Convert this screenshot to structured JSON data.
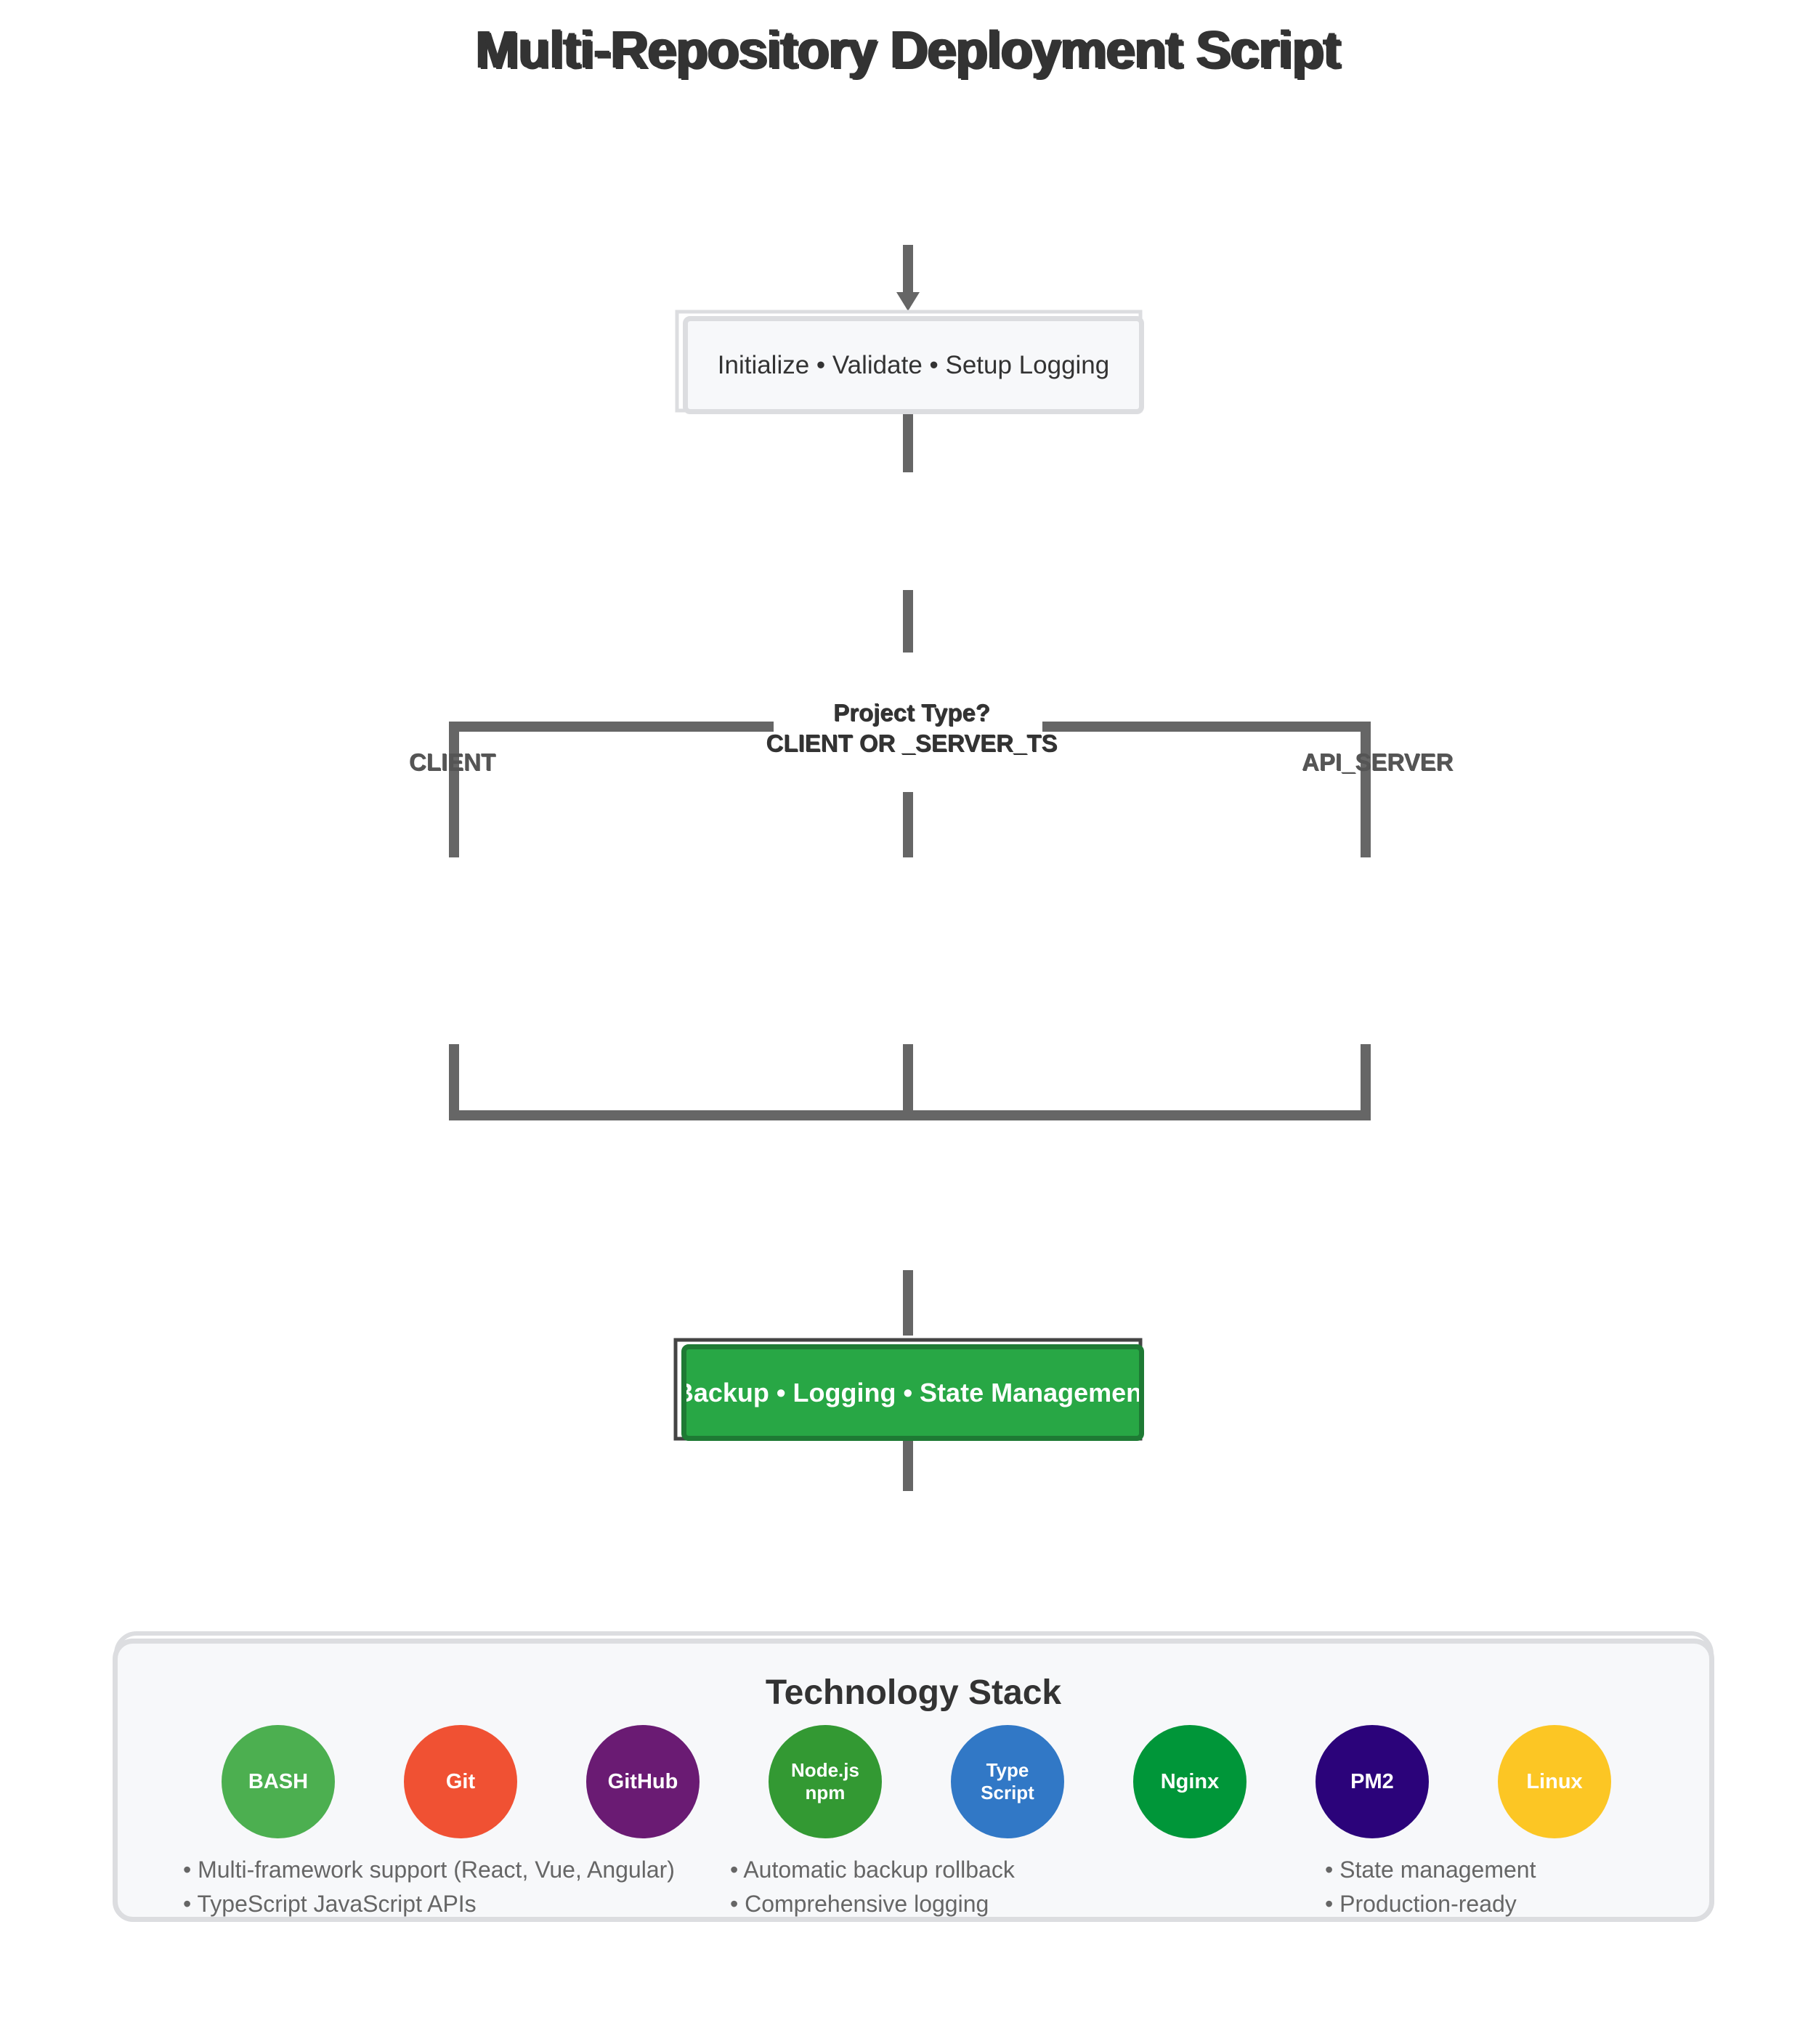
{
  "title": "Multi-Repository Deployment Script",
  "init_step": {
    "label": "Initialize • Validate • Setup Logging"
  },
  "decision": {
    "line1": "Project Type?",
    "line2": "CLIENT OR _SERVER_TS"
  },
  "branches": {
    "left": "CLIENT",
    "right": "API_SERVER"
  },
  "result_step": {
    "label": "Backup • Logging • State Management",
    "bg": "#28a745"
  },
  "tech_stack": {
    "title": "Technology Stack",
    "items": [
      {
        "label": "BASH",
        "color": "#4caf50"
      },
      {
        "label": "Git",
        "color": "#f05133"
      },
      {
        "label": "GitHub",
        "color": "#6a1b73"
      },
      {
        "label": "Node.js\nnpm",
        "color": "#339933"
      },
      {
        "label": "Type\nScript",
        "color": "#3178c6"
      },
      {
        "label": "Nginx",
        "color": "#009639"
      },
      {
        "label": "PM2",
        "color": "#2b037a"
      },
      {
        "label": "Linux",
        "color": "#fcc624"
      }
    ],
    "features_left": [
      "• Multi-framework support (React, Vue, Angular)",
      "• TypeScript JavaScript APIs"
    ],
    "features_mid": [
      "• Automatic backup rollback",
      "• Comprehensive logging"
    ],
    "features_right": [
      "• State management",
      "• Production-ready"
    ]
  }
}
